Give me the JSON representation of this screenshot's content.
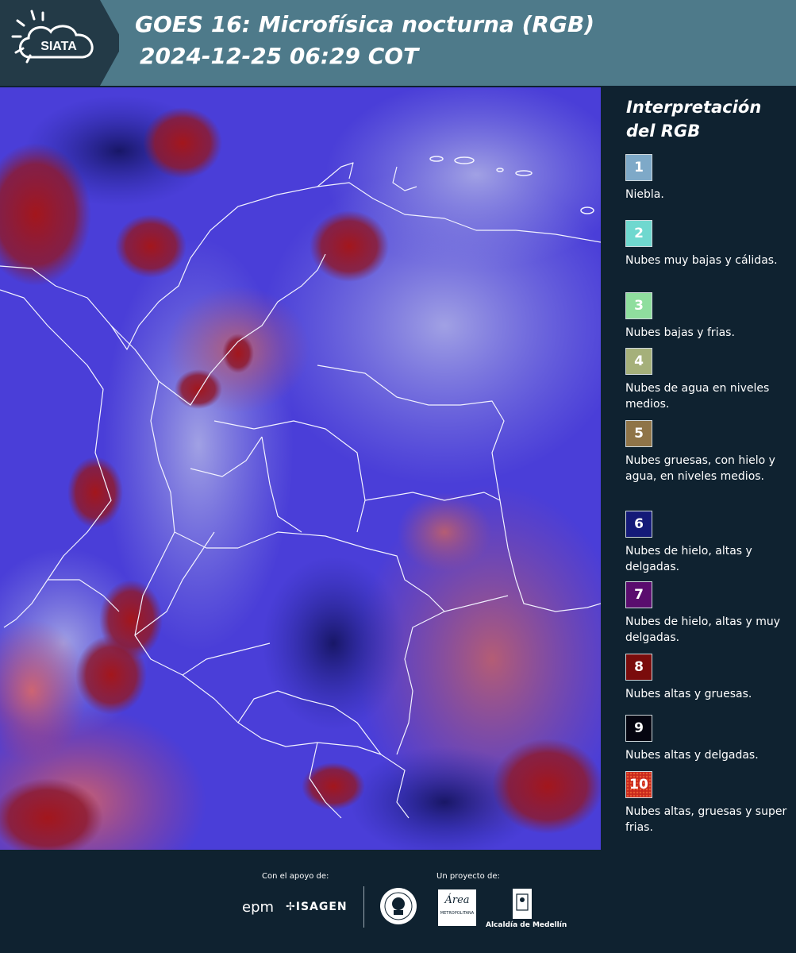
{
  "header": {
    "logo_text": "SIATA",
    "title_line1": "GOES 16: Microfísica nocturna (RGB)",
    "title_line2": "2024-12-25 06:29 COT"
  },
  "legend": {
    "title_line1": "Interpretación",
    "title_line2": "del RGB",
    "items": [
      {
        "number": "1",
        "color": "#7ea9c8",
        "description": "Niebla."
      },
      {
        "number": "2",
        "color": "#6fd8cf",
        "description": "Nubes muy bajas y cálidas."
      },
      {
        "number": "3",
        "color": "#8fde9e",
        "description": "Nubes bajas y frias."
      },
      {
        "number": "4",
        "color": "#a5b07a",
        "description": "Nubes de agua en niveles medios."
      },
      {
        "number": "5",
        "color": "#8f7448",
        "description": "Nubes gruesas, con hielo y agua, en niveles medios."
      },
      {
        "number": "6",
        "color": "#141a78",
        "description": "Nubes de hielo, altas y delgadas."
      },
      {
        "number": "7",
        "color": "#5a0d6e",
        "description": "Nubes de hielo, altas y muy delgadas."
      },
      {
        "number": "8",
        "color": "#7a0c0c",
        "description": "Nubes altas y gruesas."
      },
      {
        "number": "9",
        "color": "#050510",
        "description": "Nubes altas y delgadas."
      },
      {
        "number": "10",
        "color": "#c8281e",
        "description": "Nubes altas, gruesas y super frias."
      }
    ]
  },
  "footer": {
    "support_label": "Con el apoyo de:",
    "project_label": "Un proyecto de:",
    "sponsor1": "epm",
    "sponsor2": "ISAGEN",
    "partner_area": "Área",
    "partner_area_sub": "METROPOLITANA",
    "partner_medellin": "Alcaldía de Medellín"
  }
}
